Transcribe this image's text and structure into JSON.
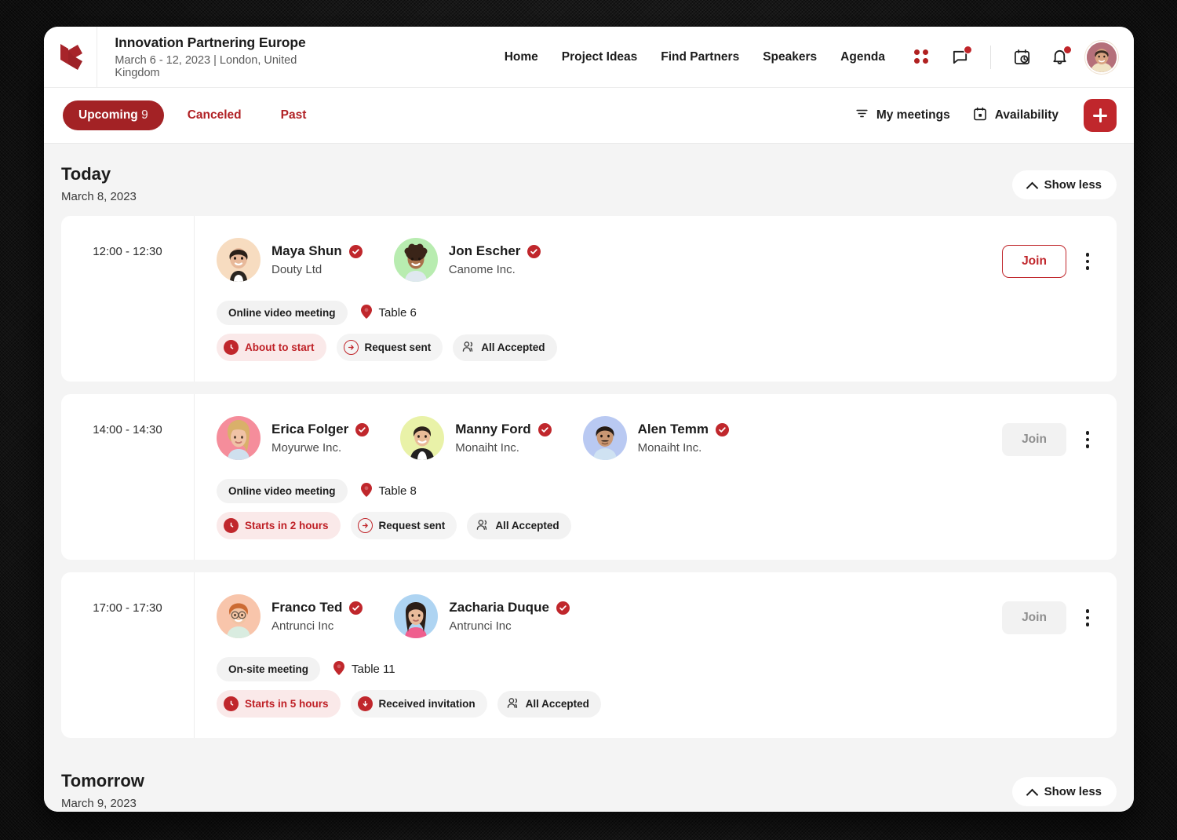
{
  "header": {
    "logo_icon": "brand-logo-icon",
    "title": "Innovation Partnering Europe",
    "subtitle": "March 6 - 12, 2023 | London, United Kingdom",
    "nav_links": [
      {
        "label": "Home"
      },
      {
        "label": "Project Ideas"
      },
      {
        "label": "Find Partners"
      },
      {
        "label": "Speakers"
      },
      {
        "label": "Agenda"
      }
    ],
    "icons": [
      {
        "name": "apps-grid-icon",
        "badge": false
      },
      {
        "name": "chat-bubble-icon",
        "badge": true
      },
      {
        "name": "calendar-clock-icon",
        "badge": false
      },
      {
        "name": "bell-notification-icon",
        "badge": true
      }
    ],
    "avatar_name": "user-avatar"
  },
  "toolbar": {
    "tabs": [
      {
        "label": "Upcoming",
        "count": "9",
        "active": true
      },
      {
        "label": "Canceled",
        "count": "",
        "active": false
      },
      {
        "label": "Past",
        "count": "",
        "active": false
      }
    ],
    "my_meetings_label": "My meetings",
    "my_meetings_icon": "filter-icon",
    "availability_label": "Availability",
    "availability_icon": "calendar-icon",
    "add_label": "+",
    "add_icon": "plus-icon"
  },
  "sections": [
    {
      "title": "Today",
      "date": "March 8, 2023",
      "show_less_label": "Show less",
      "meetings": [
        {
          "time": "12:00 - 12:30",
          "participants": [
            {
              "name": "Maya Shun",
              "company": "Douty Ltd",
              "verified": true,
              "avatar_bg": "#f7dcc0",
              "skin": "#e8b99a",
              "hair": "#2a2019"
            },
            {
              "name": "Jon Escher",
              "company": "Canome Inc.",
              "verified": true,
              "avatar_bg": "#b8ecb0",
              "skin": "#a9714b",
              "hair": "#3a2418"
            }
          ],
          "mode": "Online video meeting",
          "table": "Table 6",
          "status": "About to start",
          "request": "Request sent",
          "request_icon": "arrow-right-circle-icon",
          "accepted": "All Accepted",
          "join_label": "Join",
          "join_enabled": true
        },
        {
          "time": "14:00 - 14:30",
          "participants": [
            {
              "name": "Erica Folger",
              "company": "Moyurwe Inc.",
              "verified": true,
              "avatar_bg": "#f58d9b",
              "skin": "#f0c3a6",
              "hair": "#d9b06a"
            },
            {
              "name": "Manny Ford",
              "company": "Monaiht Inc.",
              "verified": true,
              "avatar_bg": "#e9f2a8",
              "skin": "#e9bc98",
              "hair": "#2c211a"
            },
            {
              "name": "Alen Temm",
              "company": "Monaiht Inc.",
              "verified": true,
              "avatar_bg": "#b9c9f2",
              "skin": "#c99773",
              "hair": "#241a14"
            }
          ],
          "mode": "Online video meeting",
          "table": "Table 8",
          "status": "Starts in 2 hours",
          "request": "Request sent",
          "request_icon": "arrow-right-circle-icon",
          "accepted": "All Accepted",
          "join_label": "Join",
          "join_enabled": false
        },
        {
          "time": "17:00 - 17:30",
          "participants": [
            {
              "name": "Franco Ted",
              "company": "Antrunci Inc",
              "verified": true,
              "avatar_bg": "#f8c5ab",
              "skin": "#f2c4a4",
              "hair": "#cc6b33"
            },
            {
              "name": "Zacharia Duque",
              "company": "Antrunci Inc",
              "verified": true,
              "avatar_bg": "#aed4f2",
              "skin": "#e8bb9b",
              "hair": "#2b1d16"
            }
          ],
          "mode": "On-site meeting",
          "table": "Table 11",
          "status": "Starts in 5 hours",
          "request": "Received invitation",
          "request_icon": "arrow-down-circle-filled-icon",
          "accepted": "All Accepted",
          "join_label": "Join",
          "join_enabled": false
        }
      ]
    },
    {
      "title": "Tomorrow",
      "date": "March 9, 2023",
      "show_less_label": "Show less",
      "meetings": []
    }
  ],
  "colors": {
    "brand_red": "#c0272c",
    "tab_active_bg": "#a32225",
    "alert_bg": "#fae9e9",
    "page_bg": "#f4f4f4"
  }
}
